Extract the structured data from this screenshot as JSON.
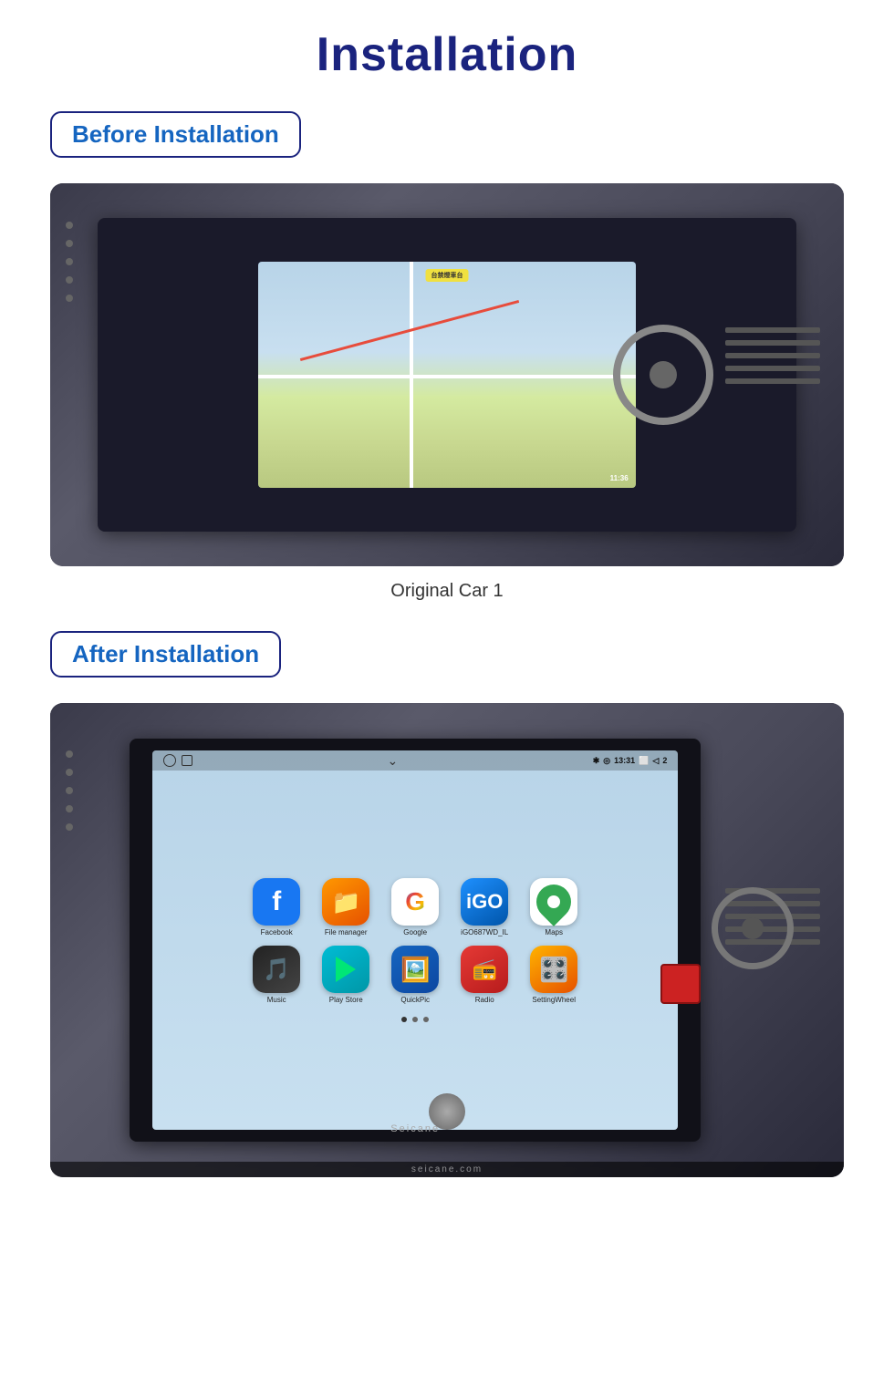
{
  "page": {
    "title": "Installation",
    "before_badge": "Before Installation",
    "after_badge": "After Installation",
    "caption": "Original Car  1",
    "seicane": "Seicane",
    "watermark": "seicane.com"
  },
  "before_image": {
    "alt": "Car dashboard before installation showing original navigation screen"
  },
  "after_image": {
    "alt": "Car dashboard after installation showing Android head unit with apps"
  },
  "android": {
    "time": "13:31",
    "apps_row1": [
      {
        "label": "Facebook",
        "icon": "facebook"
      },
      {
        "label": "File manager",
        "icon": "filemanager"
      },
      {
        "label": "Google",
        "icon": "google"
      },
      {
        "label": "iGO687WD_IL",
        "icon": "igo"
      },
      {
        "label": "Maps",
        "icon": "maps"
      }
    ],
    "apps_row2": [
      {
        "label": "Music",
        "icon": "music"
      },
      {
        "label": "Play Store",
        "icon": "playstore"
      },
      {
        "label": "QuickPic",
        "icon": "quickpic"
      },
      {
        "label": "Radio",
        "icon": "radio"
      },
      {
        "label": "SettingWheel",
        "icon": "settingwheel"
      }
    ]
  }
}
